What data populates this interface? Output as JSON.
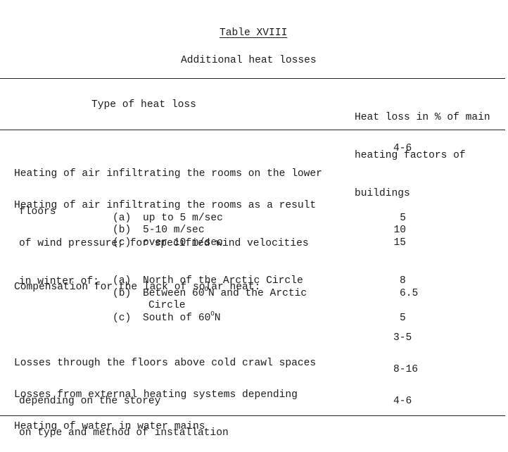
{
  "document": {
    "table_title": "Table XVIII",
    "table_subtitle": "Additional heat losses"
  },
  "table": {
    "headers": {
      "type": "Type of heat loss",
      "value_lines": [
        "Heat loss in % of main",
        "heating factors of",
        "buildings"
      ]
    },
    "rows": [
      {
        "lines": [
          "Heating of air infiltrating the rooms on the lower",
          "floors"
        ],
        "value": "4-6"
      },
      {
        "lines": [
          "Heating of air infiltrating the rooms as a result",
          "of wind pressure; for specified wind velocities",
          "in winter of:"
        ],
        "value": "",
        "subitems": [
          {
            "label": "(a)",
            "text": "up to 5 m/sec",
            "value": "5"
          },
          {
            "label": "(b)",
            "text": "5-10 m/sec",
            "value": "10"
          },
          {
            "label": "(c)",
            "text": "over 10 m/sec",
            "value": "15"
          }
        ]
      },
      {
        "lines": [
          "Compensation for the lack of solar heat:"
        ],
        "value": "",
        "subitems": [
          {
            "label": "(a)",
            "text": "North of the Arctic Circle",
            "value": "8"
          },
          {
            "label": "(b)",
            "text_pre": "Between 60",
            "sup": "O",
            "text_post": "N and the Arctic",
            "text_cont": "Circle",
            "value": "6.5"
          },
          {
            "label": "(c)",
            "text_pre": "South of 60",
            "sup": "O",
            "text_post": "N",
            "value": "5"
          }
        ]
      },
      {
        "lines": [
          "Losses through the floors above cold crawl spaces",
          "depending on the storey"
        ],
        "value": "3-5"
      },
      {
        "lines": [
          "Losses from external heating systems depending",
          "on type and method of installation"
        ],
        "value": "8-16"
      },
      {
        "lines": [
          "Heating of water in water mains"
        ],
        "value": "4-6"
      }
    ]
  }
}
